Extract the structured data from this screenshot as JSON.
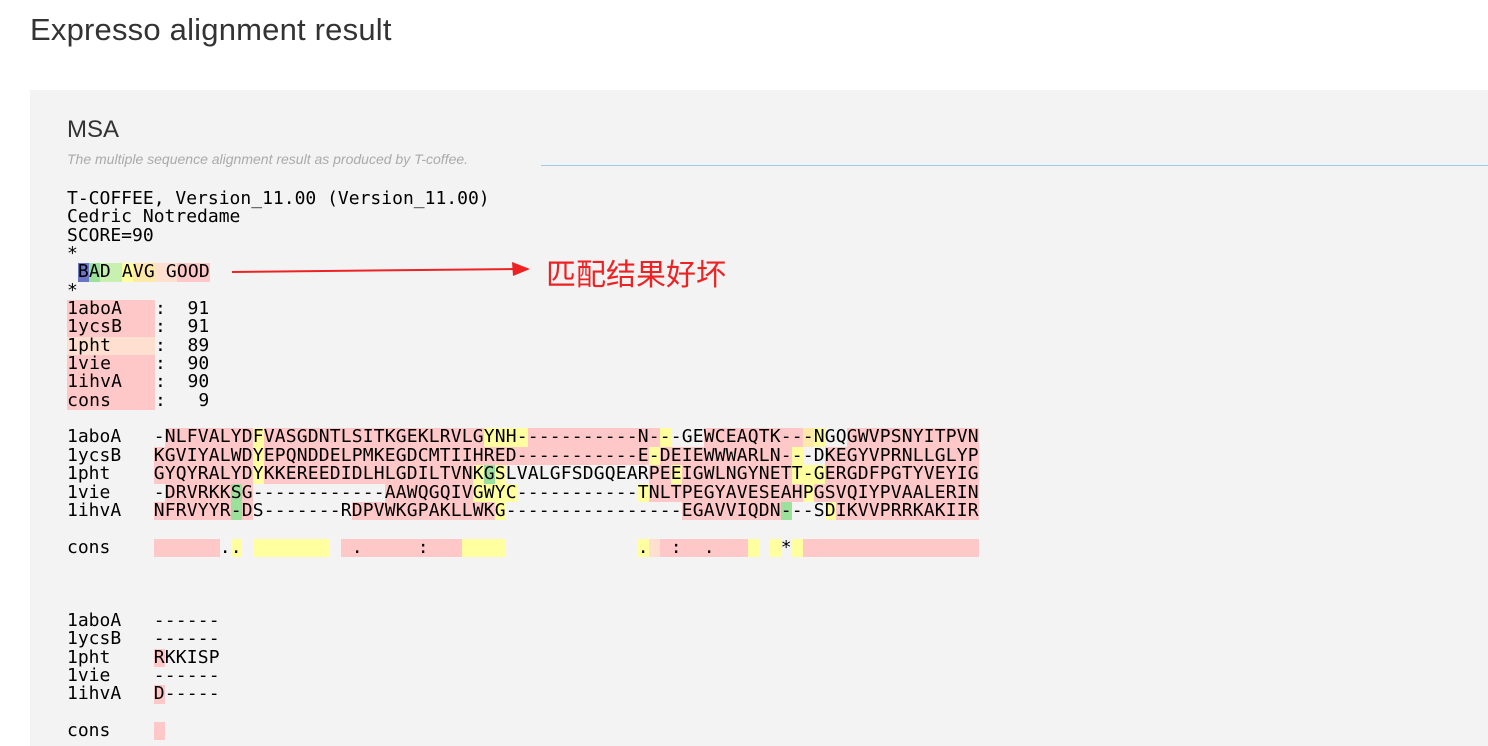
{
  "page": {
    "title": "Expresso alignment result"
  },
  "section": {
    "title": "MSA",
    "subtitle": "The multiple sequence alignment result as produced by T-coffee."
  },
  "header_lines": [
    "T-COFFEE, Version_11.00 (Version_11.00)",
    "Cedric Notredame",
    "SCORE=90",
    "*"
  ],
  "legend": {
    "prefix": " ",
    "text": "BAD AVG GOOD",
    "colors": [
      0,
      1,
      2,
      2,
      3,
      4,
      4,
      5,
      5,
      6,
      6,
      6
    ]
  },
  "legend_end": "*",
  "scores": [
    {
      "name": "1aboA",
      "sep": ":",
      "score": "91",
      "color": 6
    },
    {
      "name": "1ycsB",
      "sep": ":",
      "score": "91",
      "color": 6
    },
    {
      "name": "1pht",
      "sep": ":",
      "score": "89",
      "color": 5
    },
    {
      "name": "1vie",
      "sep": ":",
      "score": "90",
      "color": 6
    },
    {
      "name": "1ihvA",
      "sep": ":",
      "score": "90",
      "color": 6
    },
    {
      "name": "cons",
      "sep": ":",
      "score": "9",
      "color": 6
    }
  ],
  "blocks": [
    {
      "rows": [
        {
          "name": "1aboA",
          "seq": "-NLFVALYDFVASGDNTLSITKGEKLRVLGYNH-----------N---GEWCEAQTK---NGQGWVPSNYITPVN",
          "colors": "w6666666636666666666666666666633336666666666663www66666666643ww666666666666666"
        },
        {
          "name": "1ycsB",
          "seq": "KGVIYALWDYEPQNDDELPMKEGDCMTIIHRED-----------E-DEIEWWWARLN---DKEGYVPRNLLGLYP",
          "colors": "66666666636666666666666666666666666666666666636666666666663ww666666666666666"
        },
        {
          "name": "1pht",
          "seq": "GYQYRALYDYKKEREEDIDLHLGDILTVNKGSLVALGFSDGQEARPEEIGWLNGYNETT-GERGDFPGTYVEYIG",
          "colors": "66666666636666666666666666666313wwwwwwwwwwwww66366666666663336666666666666666"
        },
        {
          "name": "1vie",
          "seq": "-DRVRKKSG------------AAWQGQIVGWYC-----------TNLTPEGYAVESEAHPGSVQIYPVAALERIN",
          "colors": "w66666616wwwwwwwwwwww666666663333wwwwwwwwwww3666666666666663666666666666666"
        },
        {
          "name": "1ihvA",
          "seq": "NFRVYYR-DS-------RDPVWKGPAKLLWKG----------------EGAVVIQDN---SDIKVVPRRKAKIIR",
          "colors": "666666616wwwwwwwww66666666666663wwwwwwwwwwwwwwww6666666661www36666666666666"
        }
      ],
      "cons": {
        "name": "cons",
        "seq": "      ..          .     :                   .  :  .      *             ",
        "colors": "666666w3w3333333w666666666663333wwwwwwwwwwww35666666663w3w36666666666666666"
      }
    },
    {
      "rows": [
        {
          "name": "1aboA",
          "seq": "------",
          "colors": "wwwwww"
        },
        {
          "name": "1ycsB",
          "seq": "------",
          "colors": "wwwwww"
        },
        {
          "name": "1pht",
          "seq": "RKKISP",
          "colors": "6wwwww"
        },
        {
          "name": "1vie",
          "seq": "------",
          "colors": "wwwwww"
        },
        {
          "name": "1ihvA",
          "seq": "D-----",
          "colors": "6wwwww"
        }
      ],
      "cons": {
        "name": "cons",
        "seq": " ",
        "colors": "6"
      }
    }
  ],
  "annotation": {
    "text": "匹配结果好坏",
    "color": "#ee2222"
  }
}
